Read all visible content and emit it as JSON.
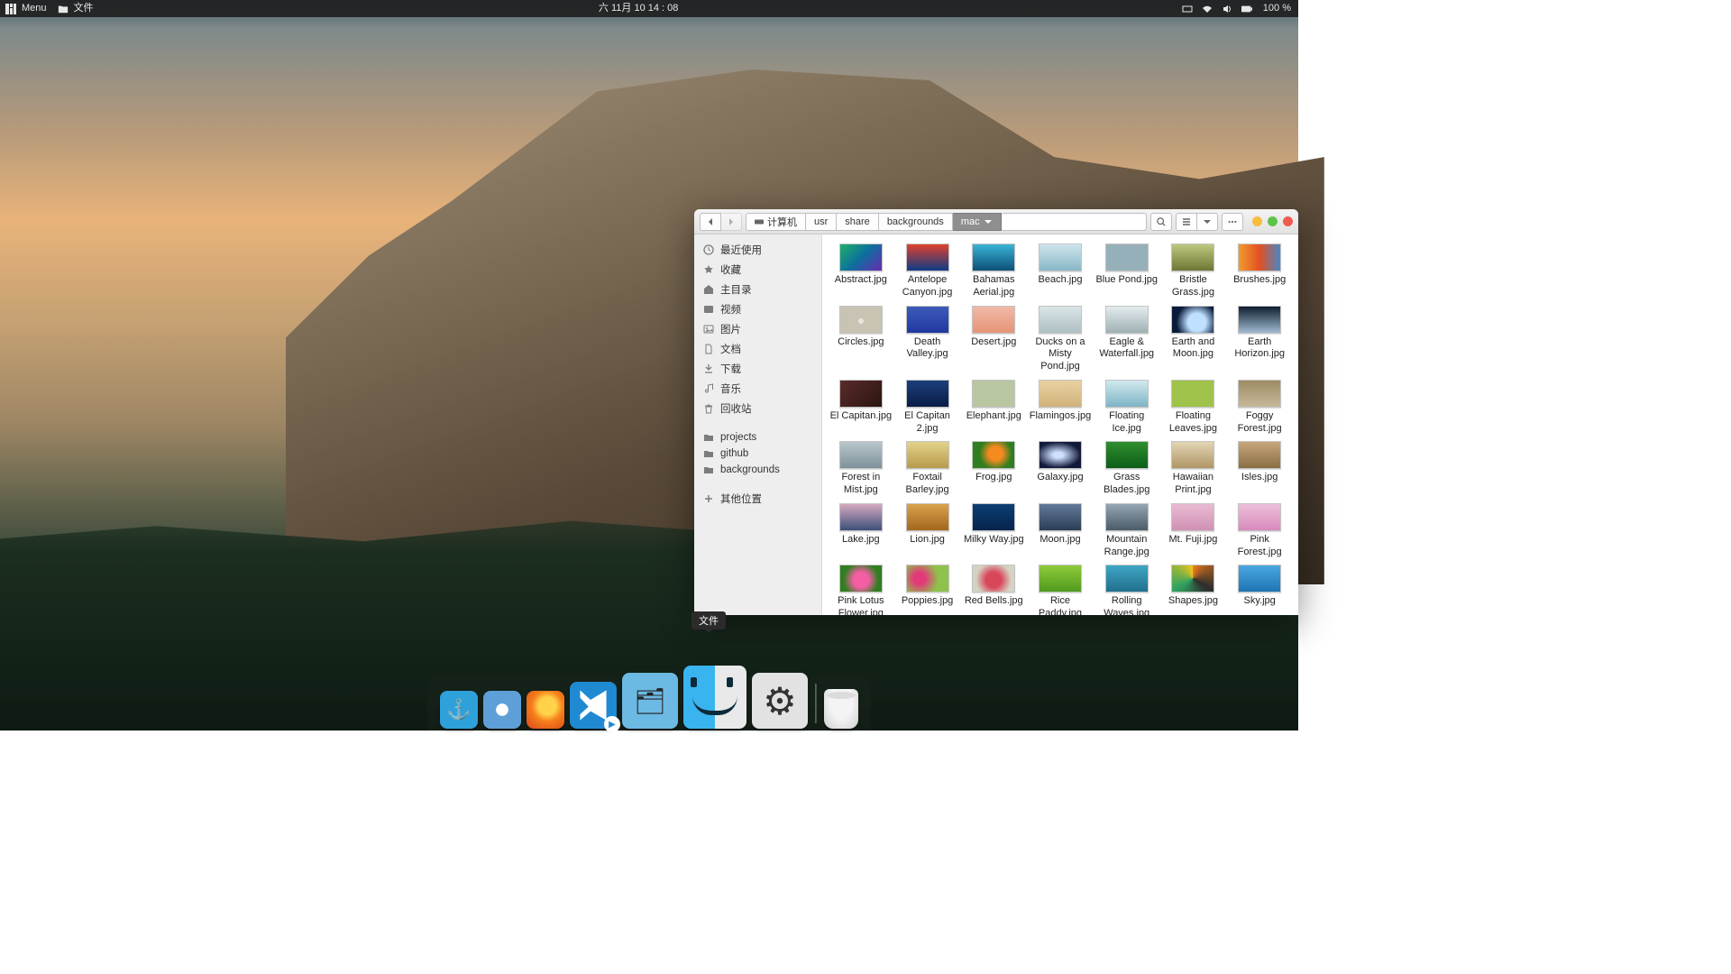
{
  "topbar": {
    "menu": "Menu",
    "app": "文件",
    "datetime": "六 11月 10  14 : 08",
    "battery": "100 %"
  },
  "fm": {
    "breadcrumb": {
      "computer": "计算机",
      "usr": "usr",
      "share": "share",
      "backgrounds": "backgrounds",
      "mac": "mac"
    },
    "sidebar": {
      "recent": "最近使用",
      "fav": "收藏",
      "home": "主目录",
      "video": "视频",
      "pictures": "图片",
      "documents": "文档",
      "downloads": "下载",
      "music": "音乐",
      "trash": "回收站",
      "projects": "projects",
      "github": "github",
      "backgrounds": "backgrounds",
      "other": "其他位置"
    },
    "files": [
      {
        "name": "Abstract.jpg",
        "thumb": "t-abstract"
      },
      {
        "name": "Antelope Canyon.jpg",
        "thumb": "t-canyon"
      },
      {
        "name": "Bahamas Aerial.jpg",
        "thumb": "t-bahamas"
      },
      {
        "name": "Beach.jpg",
        "thumb": "t-beach"
      },
      {
        "name": "Blue Pond.jpg",
        "thumb": "t-bluepond"
      },
      {
        "name": "Bristle Grass.jpg",
        "thumb": "t-bristle"
      },
      {
        "name": "Brushes.jpg",
        "thumb": "t-brushes"
      },
      {
        "name": "Circles.jpg",
        "thumb": "t-circles"
      },
      {
        "name": "Death Valley.jpg",
        "thumb": "t-death"
      },
      {
        "name": "Desert.jpg",
        "thumb": "t-desert"
      },
      {
        "name": "Ducks on a Misty Pond.jpg",
        "thumb": "t-ducks"
      },
      {
        "name": "Eagle & Waterfall.jpg",
        "thumb": "t-eagle"
      },
      {
        "name": "Earth and Moon.jpg",
        "thumb": "t-earthmoon"
      },
      {
        "name": "Earth Horizon.jpg",
        "thumb": "t-horizon"
      },
      {
        "name": "El Capitan.jpg",
        "thumb": "t-elcap"
      },
      {
        "name": "El Capitan 2.jpg",
        "thumb": "t-elcap2"
      },
      {
        "name": "Elephant.jpg",
        "thumb": "t-elephant"
      },
      {
        "name": "Flamingos.jpg",
        "thumb": "t-flamingos"
      },
      {
        "name": "Floating Ice.jpg",
        "thumb": "t-float"
      },
      {
        "name": "Floating Leaves.jpg",
        "thumb": "t-leaves"
      },
      {
        "name": "Foggy Forest.jpg",
        "thumb": "t-foggy"
      },
      {
        "name": "Forest in Mist.jpg",
        "thumb": "t-mist"
      },
      {
        "name": "Foxtail Barley.jpg",
        "thumb": "t-barley"
      },
      {
        "name": "Frog.jpg",
        "thumb": "t-frog"
      },
      {
        "name": "Galaxy.jpg",
        "thumb": "t-galaxy"
      },
      {
        "name": "Grass Blades.jpg",
        "thumb": "t-grass"
      },
      {
        "name": "Hawaiian Print.jpg",
        "thumb": "t-hawaii"
      },
      {
        "name": "Isles.jpg",
        "thumb": "t-isles"
      },
      {
        "name": "Lake.jpg",
        "thumb": "t-lake"
      },
      {
        "name": "Lion.jpg",
        "thumb": "t-lion"
      },
      {
        "name": "Milky Way.jpg",
        "thumb": "t-milky"
      },
      {
        "name": "Moon.jpg",
        "thumb": "t-moon"
      },
      {
        "name": "Mountain Range.jpg",
        "thumb": "t-range"
      },
      {
        "name": "Mt. Fuji.jpg",
        "thumb": "t-fuji"
      },
      {
        "name": "Pink Forest.jpg",
        "thumb": "t-pinkfor"
      },
      {
        "name": "Pink Lotus Flower.jpg",
        "thumb": "t-lotus"
      },
      {
        "name": "Poppies.jpg",
        "thumb": "t-poppies"
      },
      {
        "name": "Red Bells.jpg",
        "thumb": "t-redbells"
      },
      {
        "name": "Rice Paddy.jpg",
        "thumb": "t-paddy"
      },
      {
        "name": "Rolling Waves.jpg",
        "thumb": "t-waves"
      },
      {
        "name": "Shapes.jpg",
        "thumb": "t-shapes"
      },
      {
        "name": "Sky.jpg",
        "thumb": "t-sky"
      }
    ]
  },
  "dock": {
    "tooltip": "文件"
  }
}
